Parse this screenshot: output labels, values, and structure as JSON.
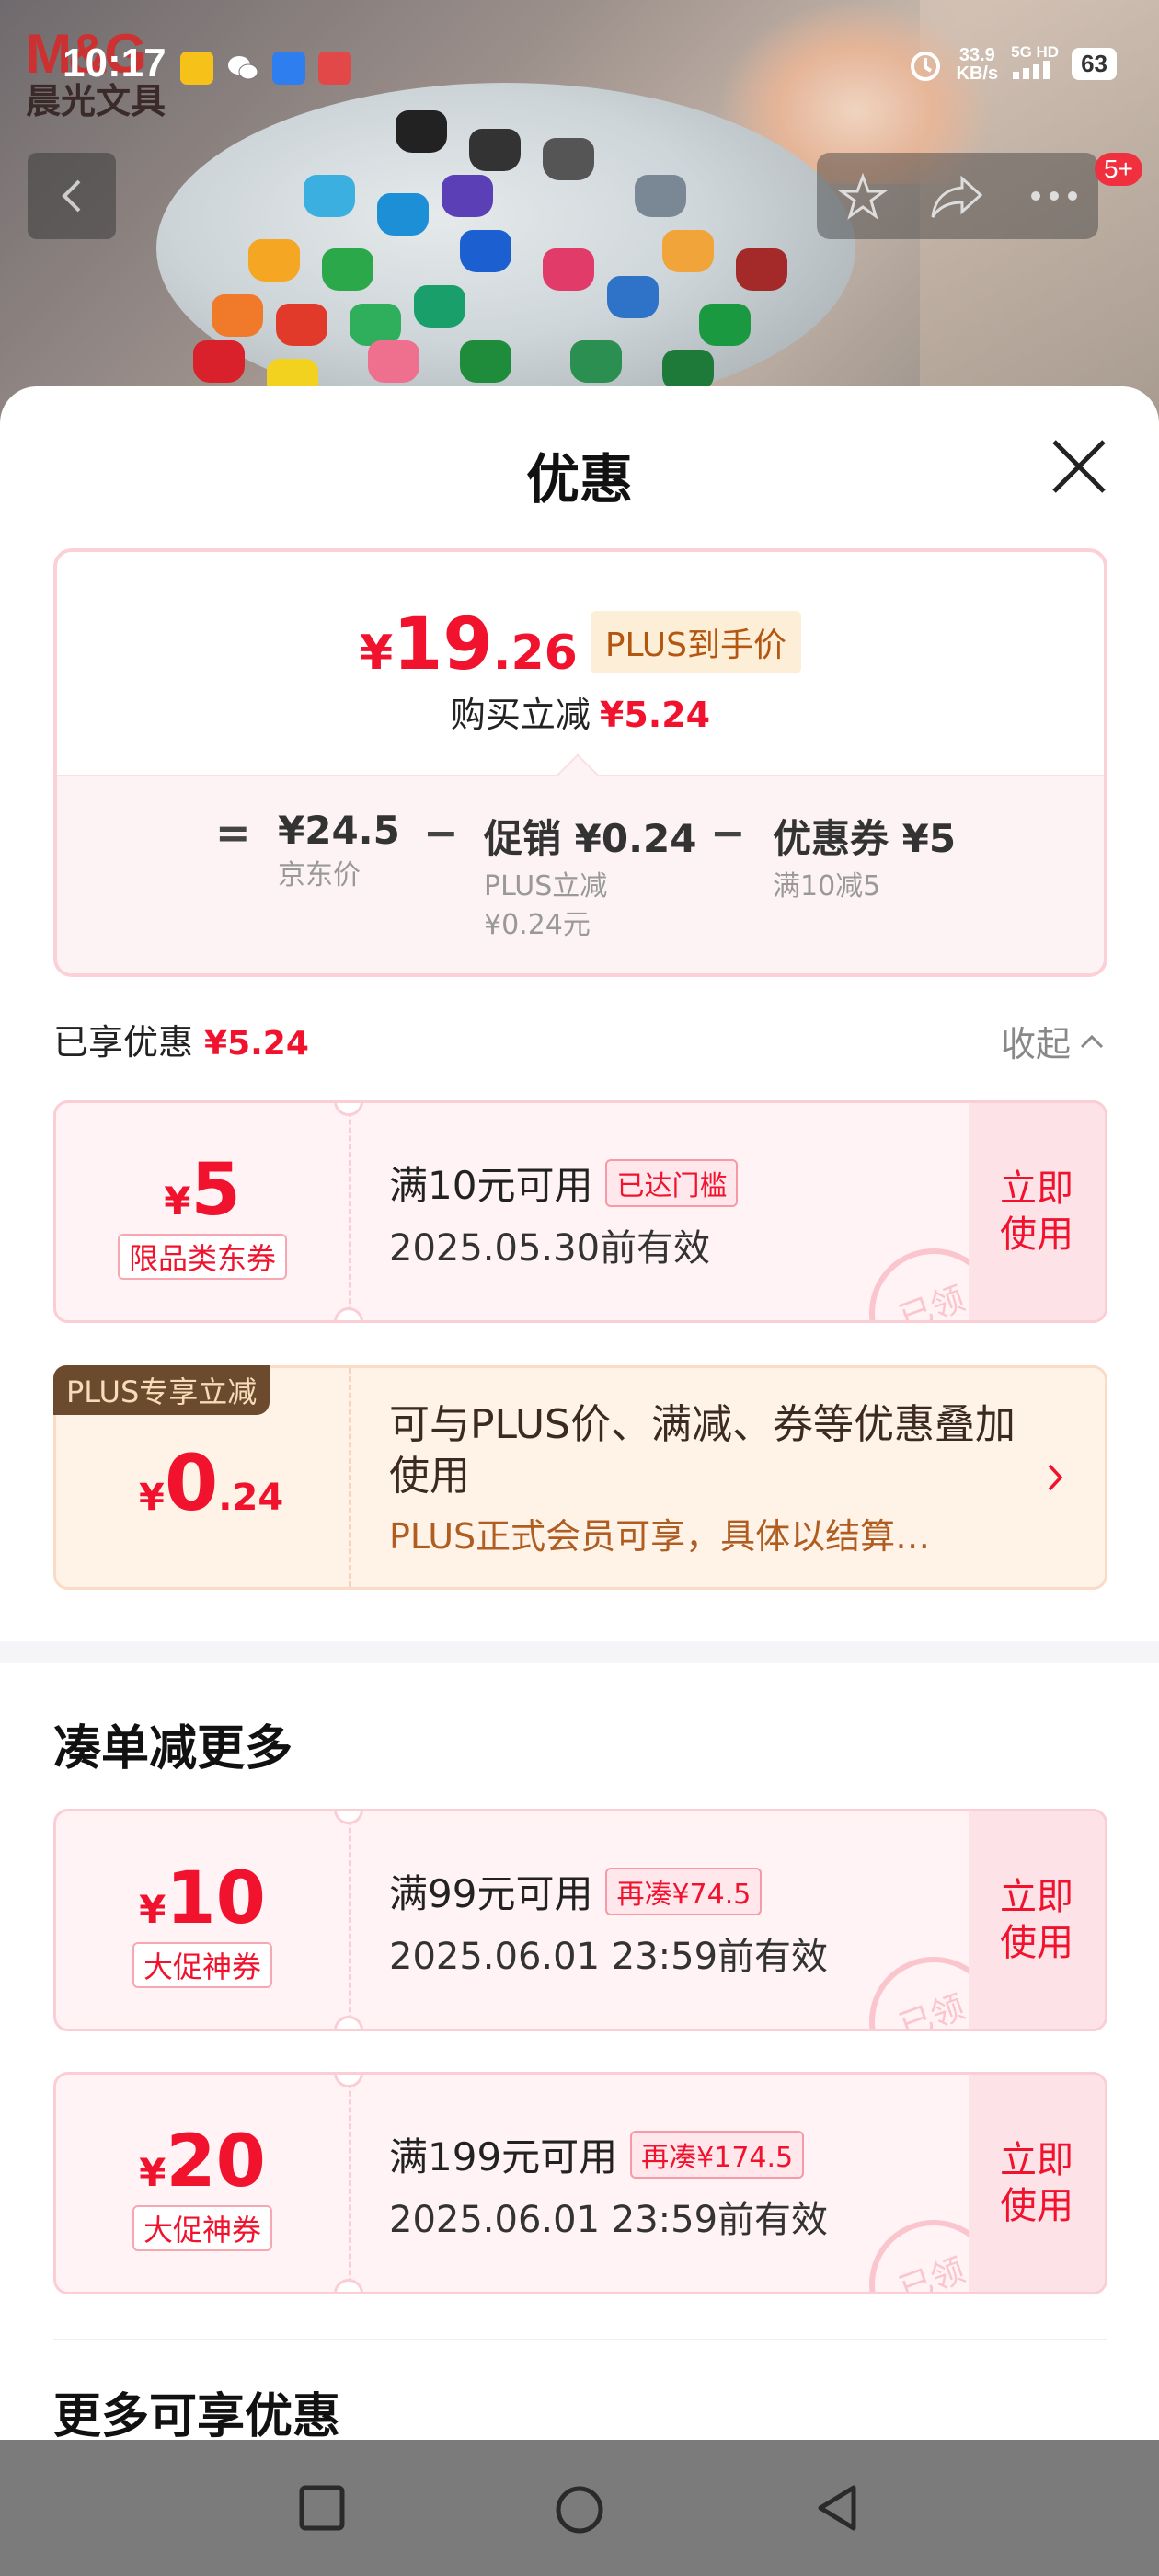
{
  "status_bar": {
    "time": "10:17",
    "net_speed_value": "33.9",
    "net_speed_unit": "KB/s",
    "network": "5G HD",
    "battery": "63"
  },
  "store_logo": {
    "mark": "M&G",
    "name": "晨光文具"
  },
  "header": {
    "badge_count": "5+"
  },
  "sheet": {
    "title": "优惠",
    "summary": {
      "currency": "¥",
      "price_int": "19",
      "price_dec": ".26",
      "price_tag": "PLUS到手价",
      "reduce_label": "购买立减",
      "reduce_value": "¥5.24",
      "eq": "=",
      "minus": "−",
      "terms": [
        {
          "value": "¥24.5",
          "sub": "京东价",
          "sub2": ""
        },
        {
          "value": "促销 ¥0.24",
          "sub": "PLUS立减",
          "sub2": "¥0.24元"
        },
        {
          "value": "优惠券 ¥5",
          "sub": "满10减5",
          "sub2": ""
        }
      ]
    },
    "enjoyed": {
      "label": "已享优惠",
      "value": "¥5.24",
      "collapse": "收起"
    },
    "coupon_enjoyed": {
      "currency": "¥",
      "amount": "5",
      "type": "限品类东券",
      "condition": "满10元可用",
      "flag": "已达门槛",
      "date": "2025.05.30前有效",
      "use": "立即使用",
      "stamp": "已领"
    },
    "plus_card": {
      "tag": "PLUS专享立减",
      "currency": "¥",
      "amount_int": "0",
      "amount_dec": ".24",
      "line1": "可与PLUS价、满减、券等优惠叠加使用",
      "line2": "PLUS正式会员可享，具体以结算…"
    },
    "more_section": {
      "title": "凑单减更多"
    },
    "coupons_more": [
      {
        "currency": "¥",
        "amount": "10",
        "type": "大促神券",
        "condition": "满99元可用",
        "flag": "再凑¥74.5",
        "date": "2025.06.01 23:59前有效",
        "use": "立即使用",
        "stamp": "已领"
      },
      {
        "currency": "¥",
        "amount": "20",
        "type": "大促神券",
        "condition": "满199元可用",
        "flag": "再凑¥174.5",
        "date": "2025.06.01 23:59前有效",
        "use": "立即使用",
        "stamp": "已领"
      }
    ],
    "more_offers": {
      "title": "更多可享优惠"
    }
  },
  "colors": {
    "accent": "#f1122d",
    "plus": "#b05d22",
    "nav_bg": "#7b7b7b"
  },
  "icons": [
    "back-icon",
    "star-icon",
    "share-icon",
    "more-icon",
    "close-icon",
    "chevron-up-icon",
    "chevron-right-icon",
    "square-nav-icon",
    "circle-nav-icon",
    "triangle-back-nav-icon"
  ]
}
